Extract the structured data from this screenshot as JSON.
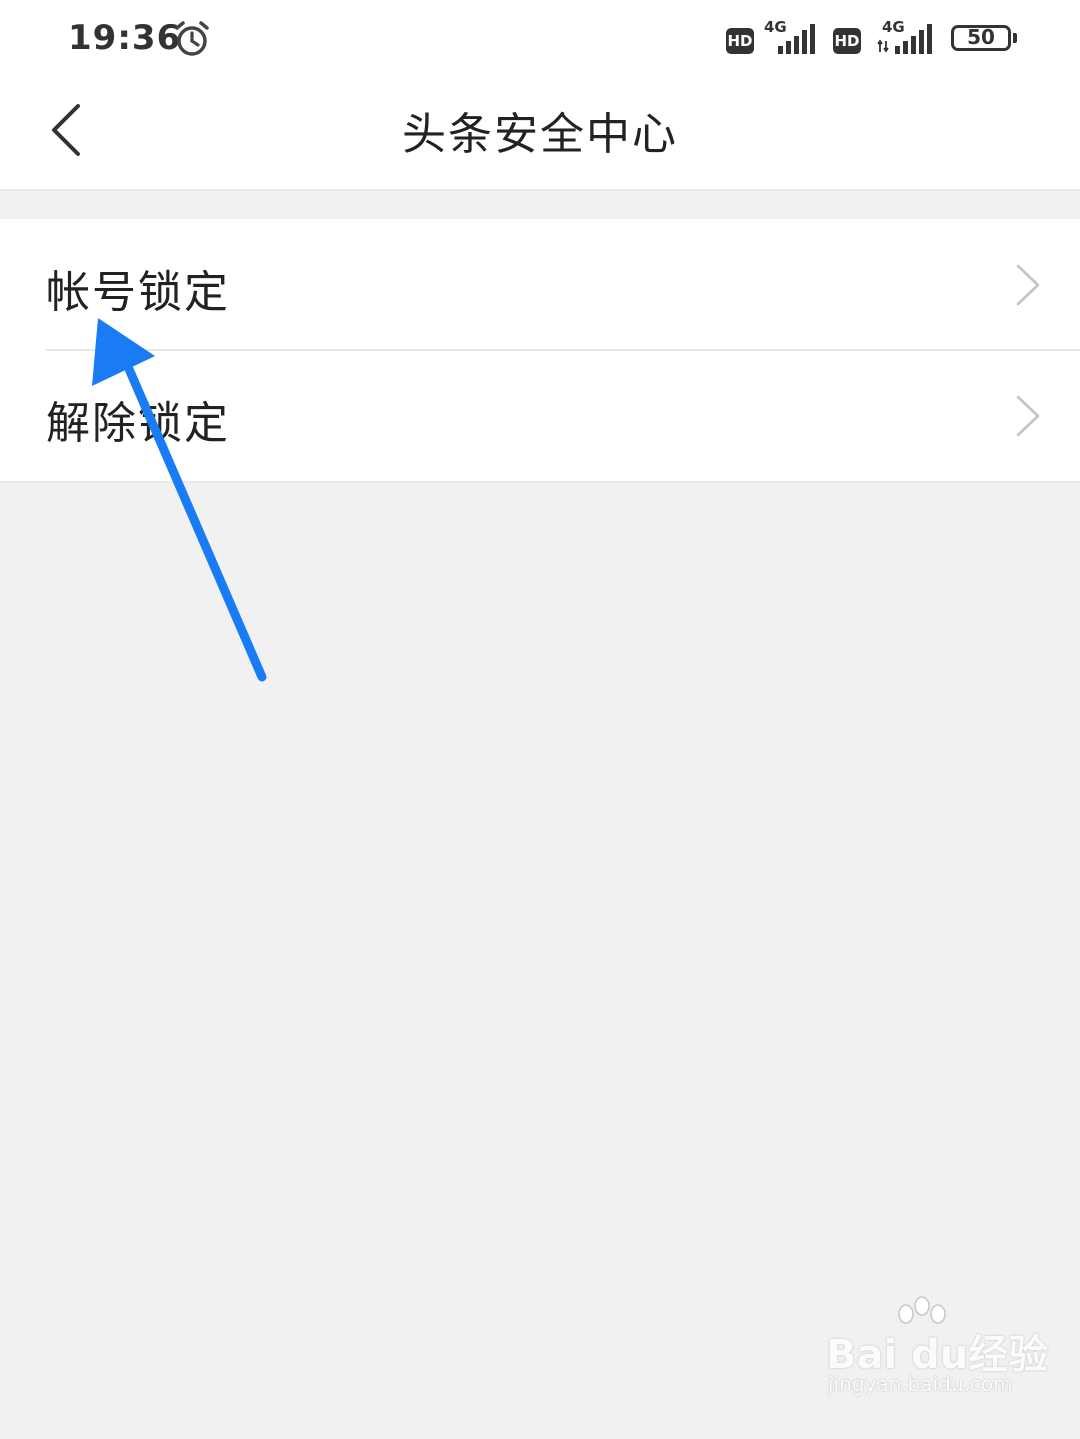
{
  "status_bar": {
    "time": "19:36",
    "hd_badge_1": "HD",
    "network_1": "4G",
    "hd_badge_2": "HD",
    "network_2": "4G",
    "battery_level": "50",
    "icons": [
      "alarm-clock-icon",
      "signal-icon",
      "battery-icon"
    ]
  },
  "header": {
    "title": "头条安全中心",
    "back_icon": "back-chevron-icon"
  },
  "menu": {
    "items": [
      {
        "label": "帐号锁定",
        "icon": "chevron-right-icon"
      },
      {
        "label": "解除锁定",
        "icon": "chevron-right-icon"
      }
    ]
  },
  "annotation": {
    "icon": "pointer-arrow-icon",
    "color": "#1a7cf5"
  },
  "watermark": {
    "logo": "Bai du经验",
    "url": "jingyan.baidu.com"
  },
  "colors": {
    "background": "#f1f1f1",
    "surface": "#ffffff",
    "divider": "#e6e6e6",
    "text": "#222222"
  }
}
